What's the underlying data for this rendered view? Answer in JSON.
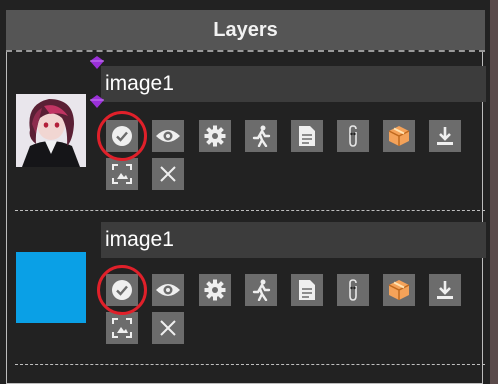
{
  "panel": {
    "title": "Layers"
  },
  "layers": [
    {
      "name": "image1",
      "thumbnail": "anime-portrait",
      "actions": [
        "check-icon",
        "eye-icon",
        "gear-icon",
        "run-icon",
        "document-icon",
        "clip-icon",
        "package-icon",
        "download-icon",
        "fit-image-icon",
        "close-icon"
      ]
    },
    {
      "name": "image1",
      "thumbnail": "solid-blue",
      "thumbnail_color": "#0aa0e6",
      "actions": [
        "check-icon",
        "eye-icon",
        "gear-icon",
        "run-icon",
        "document-icon",
        "clip-icon",
        "package-icon",
        "download-icon",
        "fit-image-icon",
        "close-icon"
      ]
    }
  ],
  "colors": {
    "highlight_ring": "#e0202a",
    "handle": "#9b30d9",
    "package_button": "#f4a259"
  }
}
